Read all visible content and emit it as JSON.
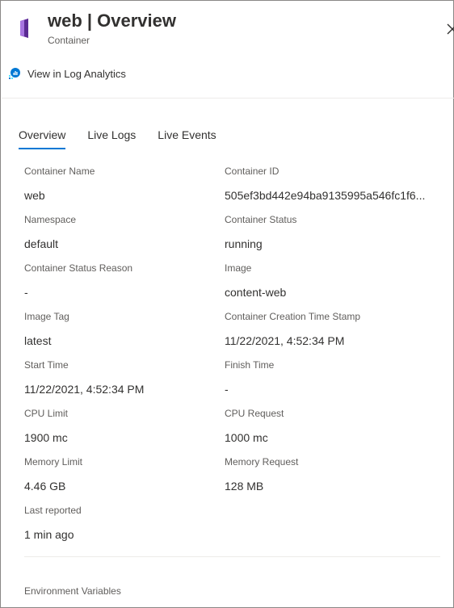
{
  "header": {
    "title": "web | Overview",
    "subtitle": "Container",
    "icon": "container-icon",
    "close_icon": "close-icon"
  },
  "log_link": {
    "label": "View in Log Analytics",
    "icon": "log-analytics-icon"
  },
  "tabs": [
    {
      "label": "Overview",
      "active": true
    },
    {
      "label": "Live Logs",
      "active": false
    },
    {
      "label": "Live Events",
      "active": false
    }
  ],
  "properties": [
    {
      "label": "Container Name",
      "value": "web"
    },
    {
      "label": "Container ID",
      "value": "505ef3bd442e94ba9135995a546fc1f6..."
    },
    {
      "label": "Namespace",
      "value": "default"
    },
    {
      "label": "Container Status",
      "value": "running"
    },
    {
      "label": "Container Status Reason",
      "value": "-"
    },
    {
      "label": "Image",
      "value": "content-web"
    },
    {
      "label": "Image Tag",
      "value": "latest"
    },
    {
      "label": "Container Creation Time Stamp",
      "value": "11/22/2021, 4:52:34 PM"
    },
    {
      "label": "Start Time",
      "value": "11/22/2021, 4:52:34 PM"
    },
    {
      "label": "Finish Time",
      "value": "-"
    },
    {
      "label": "CPU Limit",
      "value": "1900 mc"
    },
    {
      "label": "CPU Request",
      "value": "1000 mc"
    },
    {
      "label": "Memory Limit",
      "value": "4.46 GB"
    },
    {
      "label": "Memory Request",
      "value": "128 MB"
    },
    {
      "label": "Last reported",
      "value": "1 min ago"
    }
  ],
  "env_section": {
    "label": "Environment Variables"
  },
  "colors": {
    "accent": "#0078d4",
    "icon_purple": "#7a3bb8"
  }
}
